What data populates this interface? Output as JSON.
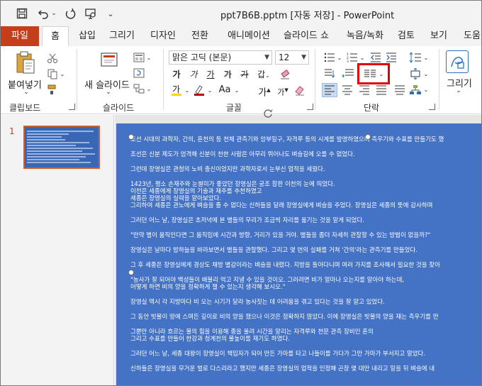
{
  "titlebar": {
    "title": "ppt7B6B.pptm [자동 저장]  -  PowerPoint",
    "icons": [
      "save-icon",
      "undo-icon",
      "redo-icon",
      "present-from-start-icon",
      "customize-qat-icon"
    ]
  },
  "tabs": [
    "파일",
    "홈",
    "삽입",
    "그리기",
    "디자인",
    "전환",
    "애니메이션",
    "슬라이드 쇼",
    "녹음/녹화",
    "검토",
    "보기",
    "도움말"
  ],
  "ribbon": {
    "clipboard": {
      "paste_label": "붙여넣기",
      "group_label": "클립보드"
    },
    "slides": {
      "new_slide_label": "새 슬라이드",
      "group_label": "슬라이드"
    },
    "font": {
      "font_name": "맑은 고딕 (본문)",
      "font_size": "12",
      "bold": "가",
      "italic": "가",
      "underline": "가",
      "strike": "가",
      "char_spacing": "갑",
      "grow": "가",
      "shrink": "가",
      "case": "Aa",
      "group_label": "글꼴"
    },
    "paragraph": {
      "group_label": "단락",
      "columns_highlighted": true
    },
    "drawing": {
      "label": "그리기"
    }
  },
  "thumbnail": {
    "number": "1"
  },
  "slide": {
    "paragraphs": [
      [
        "조선 시대의 과학자, 간의, 혼천의 등 천체 관측기와 앙부일구, 자격루 등의 시계를 발명하였으며  측우기와 수표를 만들기도 했"
      ],
      [
        "조선은 신분 제도가 엄격해 신분이 천한 사람은 아무리 뛰어나도 벼슬길에 오를 수 없었다."
      ],
      [
        "그런데 장영실은 관청의 노비 출신이었지만 과학자로서 눈부신 업적을 세웠다."
      ],
      [
        "1423년, 평소 손재주와 눈썰미가 좋았던 장영실은 궁조 참판 이천의 눈에 띄었다.",
        "  이천은 세종에게 장영실의 기술과 재주를 추천하였고",
        "세종은 장영실의 실력을 알아보았다.",
        "그리하여 세종은 관노에게 벼슬을 줄 수 없다는 신하들을 달래 장영실에게 벼슬을 주었다. 장영실은 세종의 뜻에 감사하며"
      ],
      [
        "그러던 어느 날, 장영실은 초저녁에 본 별들의 무리가 조금씩 자리를 옮기는 것을 알게 되었다."
      ],
      [
        "\"만약 별이 움직인다면 그 움직임에 시간과 방향, 거리가 있을 거야. 별들을 좀더 자세히 관찰할 수 있는 방법이 없을까?\""
      ],
      [
        "장영실은 날마다 밤하늘을 바라보면서 별들을 관찰했다. 그리고 몇 번의 실패를 거쳐 '간의'라는 관측기를 만들었다."
      ],
      [
        "그 후 세종은 장영실에게 경상도 채방 별감이라는 벼슬을 내렸다. 지방을 돌아다니며 여러 가지를 조사해서 필요한 것을 찾아"
      ],
      [
        "\"농사가 잘 되어야 백성들이 배불리 먹고 지낼 수 있을 것이오. 그러려면 비가 얼마나 오는지를 알아야 하는데,",
        "어떻게 하면 비의 양을 정확하게 잴 수 있는지 생각해 보시오.\""
      ],
      [
        "장영실 역시 각 지방마다 비 오는 시기가 달라 농사짓는 데 어려움을 겪고 있다는 것을 잘 알고 있었다."
      ],
      [
        "그 동안 빗물이 땅에 스며든 깊이로 비의 양을 쟀으나 이것은 정확하지 않았다. 이에 장영실은 빗물의 양을 재는 측우기를 만"
      ],
      [
        "그뿐만 아니라 흐르는 물의 힘을 이용해 종을 울려 시간을 알리는 자격루와 천문 관측 장비인 혼의",
        "그리고 수표를 만들어 한강과 청계천의 물높이를 재기도 하였다."
      ],
      [
        "그러던 어느 날, 세종 대왕이 장영실이 책임자가 되어 만든 가마를 타고 나들이를 가다가 그만 가마가 부서지고 말았다."
      ],
      [
        "신하들은 장영실을 무거운 벌로 다스리라고 했지만 세종은 장영실의 업적을 인정해 곤장 몇 대만 내리고 일을 뒤 벼슬에 내"
      ]
    ]
  }
}
